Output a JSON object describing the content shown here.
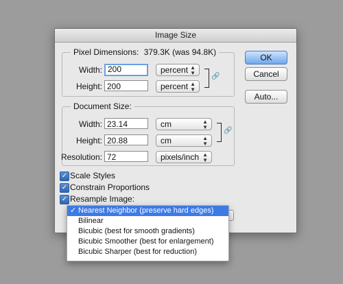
{
  "dialog": {
    "title": "Image Size",
    "pixel_dimensions": {
      "legend": "Pixel Dimensions:",
      "size_text": "379.3K (was 94.8K)",
      "width": {
        "label": "Width:",
        "value": "200",
        "unit": "percent"
      },
      "height": {
        "label": "Height:",
        "value": "200",
        "unit": "percent"
      }
    },
    "document_size": {
      "legend": "Document Size:",
      "width": {
        "label": "Width:",
        "value": "23.14",
        "unit": "cm"
      },
      "height": {
        "label": "Height:",
        "value": "20.88",
        "unit": "cm"
      },
      "resolution": {
        "label": "Resolution:",
        "value": "72",
        "unit": "pixels/inch"
      }
    },
    "options": {
      "scale_styles": {
        "label": "Scale Styles",
        "checked": true
      },
      "constrain_proportions": {
        "label": "Constrain Proportions",
        "checked": true
      },
      "resample_image": {
        "label": "Resample Image:",
        "checked": true
      }
    },
    "buttons": {
      "ok": "OK",
      "cancel": "Cancel",
      "auto": "Auto..."
    },
    "resample_menu": {
      "selected_index": 0,
      "items": [
        "Nearest Neighbor (preserve hard edges)",
        "Bilinear",
        "Bicubic (best for smooth gradients)",
        "Bicubic Smoother (best for enlargement)",
        "Bicubic Sharper (best for reduction)"
      ]
    }
  }
}
